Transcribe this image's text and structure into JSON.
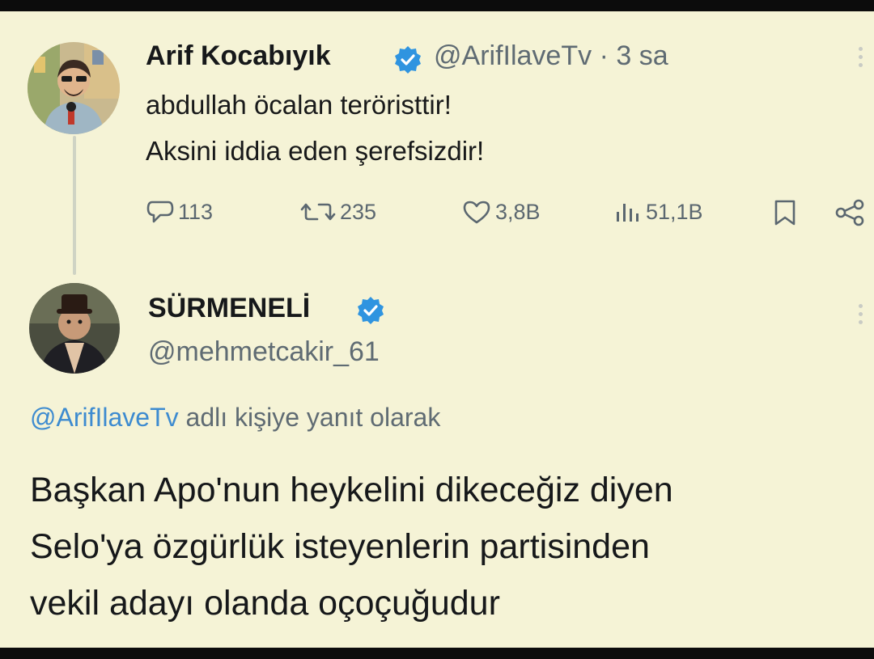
{
  "tweet1": {
    "display_name": "Arif Kocabıyık",
    "handle": "@ArifIlaveTv",
    "separator": "·",
    "time": "3 sa",
    "text_lines": [
      "abdullah öcalan teröristtir!",
      "Aksini iddia eden şerefsizdir!"
    ],
    "stats": {
      "replies": "113",
      "retweets": "235",
      "likes": "3,8B",
      "views": "51,1B"
    }
  },
  "tweet2": {
    "display_name": "SÜRMENELİ",
    "handle": "@mehmetcakir_61",
    "reply_mention": "@ArifIlaveTv",
    "reply_rest": " adlı kişiye yanıt olarak",
    "text_lines": [
      "Başkan Apo'nun heykelini dikeceğiz diyen",
      "Selo'ya özgürlük isteyenlerin partisinden",
      "vekil adayı olanda oçoçuğudur"
    ]
  },
  "colors": {
    "background": "#f5f3d6",
    "verified": "#2f94e0",
    "mention": "#3d8bd0",
    "secondary_text": "#5f6b73"
  },
  "icons": [
    "avatar",
    "verified-badge-icon",
    "more-icon",
    "reply-icon",
    "retweet-icon",
    "like-icon",
    "views-icon",
    "bookmark-icon",
    "share-icon"
  ]
}
